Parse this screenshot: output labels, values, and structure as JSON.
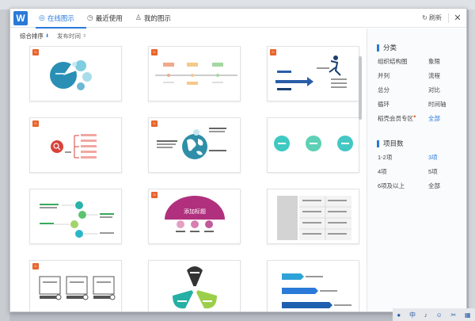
{
  "app": {
    "logo": "W"
  },
  "tabs": [
    {
      "icon": "globe-icon",
      "glyph": "◎",
      "label": "在线图示"
    },
    {
      "icon": "clock-icon",
      "glyph": "◷",
      "label": "最近使用"
    },
    {
      "icon": "user-icon",
      "glyph": "♙",
      "label": "我的图示"
    }
  ],
  "toolbar": {
    "refresh_glyph": "↻",
    "refresh_label": "刷新",
    "close_glyph": "✕"
  },
  "sort": [
    {
      "label": "综合排序",
      "arrow": "⬇"
    },
    {
      "label": "发布时间",
      "arrow": "⇕"
    }
  ],
  "cards": [
    {
      "name": "pie-chart-template"
    },
    {
      "name": "timeline-template"
    },
    {
      "name": "runner-arrow-template"
    },
    {
      "name": "search-list-template"
    },
    {
      "name": "globe-text-template"
    },
    {
      "name": "three-circles-template"
    },
    {
      "name": "funnel-steps-template"
    },
    {
      "name": "semicircle-title-template",
      "title": "添加标题"
    },
    {
      "name": "table-grid-template"
    },
    {
      "name": "three-boxes-template"
    },
    {
      "name": "tri-petal-template"
    },
    {
      "name": "arrow-ribbon-template"
    }
  ],
  "panel": {
    "category_title": "分类",
    "categories": [
      "组织结构图",
      "象限",
      "并列",
      "流程",
      "总分",
      "对比",
      "循环",
      "时间轴",
      "稻壳会员专区",
      "全部"
    ],
    "category_selected": "全部",
    "category_badge": "●",
    "count_title": "项目数",
    "counts": [
      "1-2项",
      "3项",
      "4项",
      "5项",
      "6项及以上",
      "全部"
    ],
    "count_selected": "3项"
  },
  "tray": [
    "●",
    "中",
    "♪",
    "☺",
    "✂",
    "▦"
  ]
}
